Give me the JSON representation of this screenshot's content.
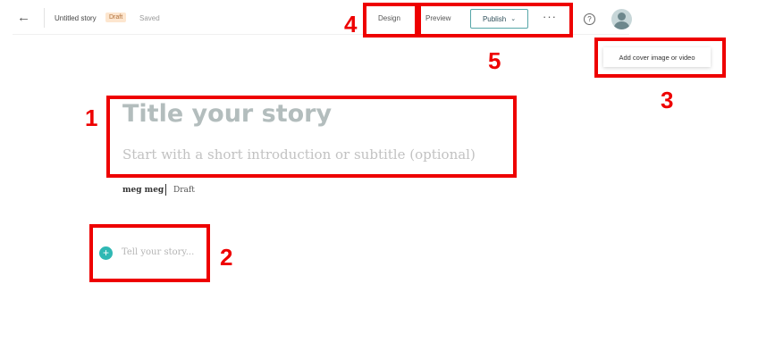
{
  "topbar": {
    "back_icon": "arrow-left-icon",
    "doc_title": "Untitled story",
    "status_badge": "Draft",
    "saved_text": "Saved",
    "design_label": "Design",
    "preview_label": "Preview",
    "publish_label": "Publish",
    "more_icon": "more-horizontal-icon",
    "help_icon": "help-circle-icon",
    "avatar_icon": "user-avatar-icon"
  },
  "cover": {
    "label": "Add cover image or video"
  },
  "editor": {
    "title_placeholder": "Title your story",
    "subtitle_placeholder": "Start with a short introduction or subtitle (optional)",
    "author": "meg meg",
    "author_status": "Draft",
    "story_placeholder": "Tell your story..."
  },
  "callouts": [
    "1",
    "2",
    "3",
    "4",
    "5"
  ],
  "colors": {
    "accent": "#2fb8b4",
    "publish_border": "#56a6a8",
    "badge_bg": "#fde6cf",
    "callout": "#ee0000"
  }
}
